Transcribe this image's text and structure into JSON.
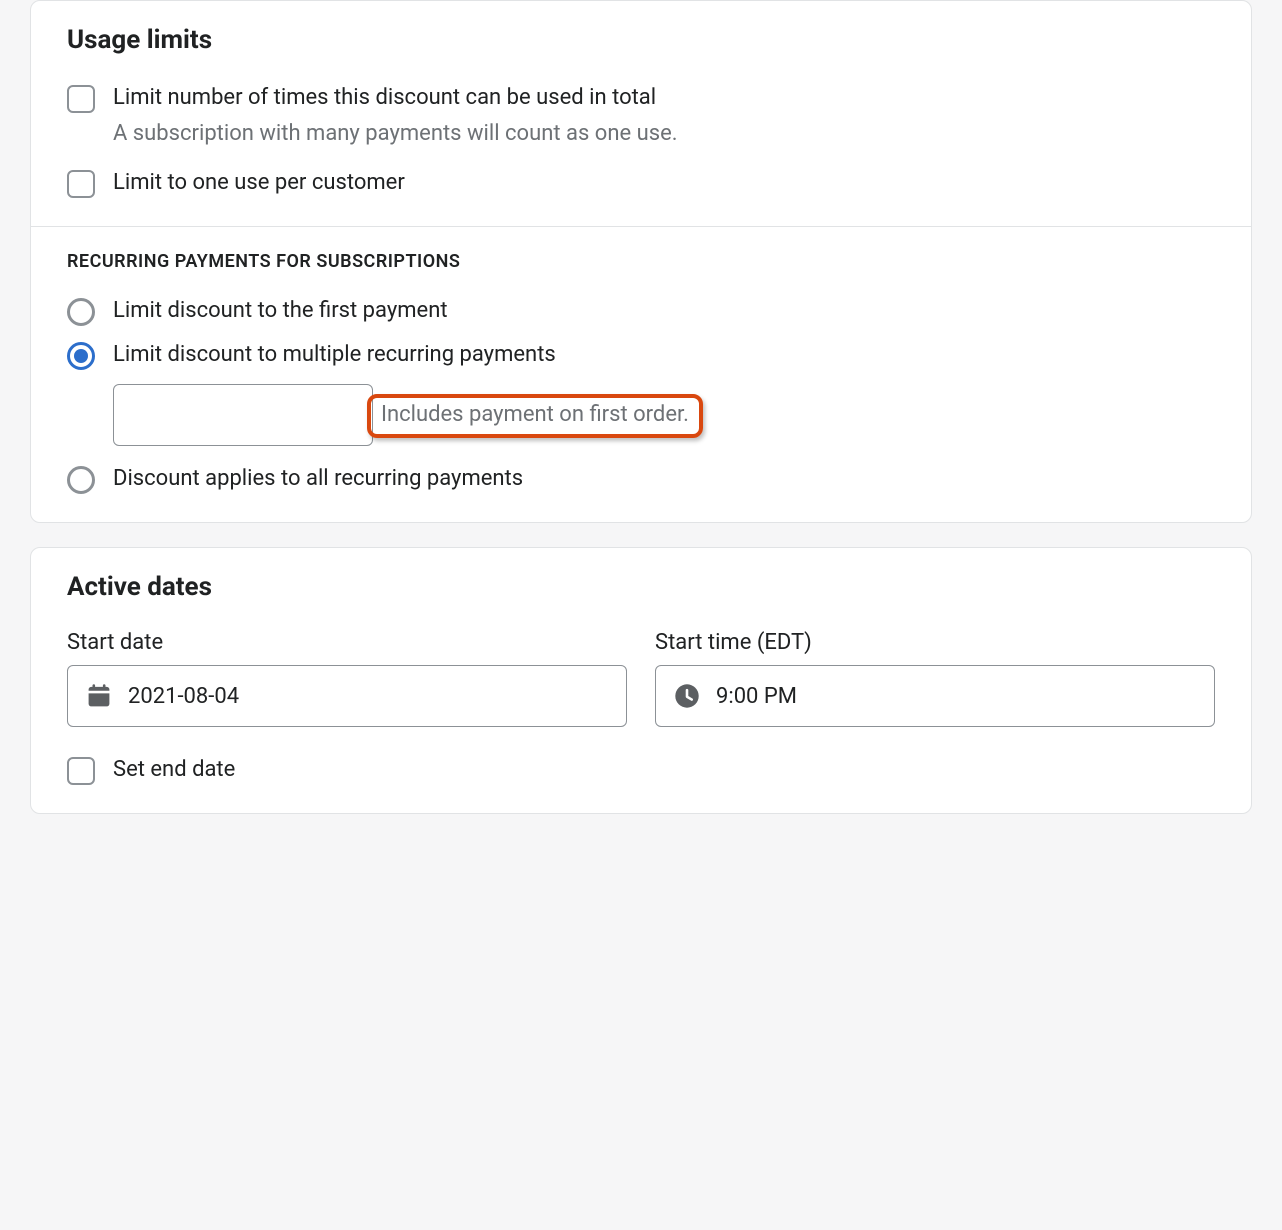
{
  "usage_limits": {
    "title": "Usage limits",
    "limit_total": {
      "label": "Limit number of times this discount can be used in total",
      "help": "A subscription with many payments will count as one use.",
      "checked": false
    },
    "limit_per_customer": {
      "label": "Limit to one use per customer",
      "checked": false
    }
  },
  "recurring": {
    "heading": "RECURRING PAYMENTS FOR SUBSCRIPTIONS",
    "options": {
      "first_payment": {
        "label": "Limit discount to the first payment",
        "selected": false
      },
      "multiple_payments": {
        "label": "Limit discount to multiple recurring payments",
        "selected": true,
        "input_value": "",
        "helper": "Includes payment on first order."
      },
      "all_payments": {
        "label": "Discount applies to all recurring payments",
        "selected": false
      }
    }
  },
  "active_dates": {
    "title": "Active dates",
    "start_date": {
      "label": "Start date",
      "value": "2021-08-04"
    },
    "start_time": {
      "label": "Start time (EDT)",
      "value": "9:00 PM"
    },
    "set_end_date": {
      "label": "Set end date",
      "checked": false
    }
  }
}
